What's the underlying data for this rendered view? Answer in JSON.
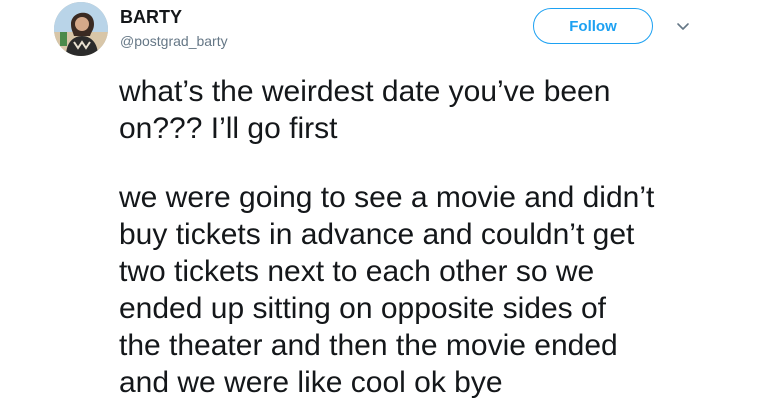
{
  "user": {
    "display_name": "BARTY",
    "handle": "@postgrad_barty"
  },
  "actions": {
    "follow_label": "Follow",
    "more_icon": "chevron-down-icon"
  },
  "tweet": {
    "paragraph_1": "what’s the weirdest date you’ve been\non??? I’ll go first",
    "paragraph_2": "we were going to see a movie and didn’t\nbuy tickets in advance and couldn’t get\ntwo tickets next to each other so we\nended up sitting on opposite sides of\nthe theater and then the movie ended\nand we were like cool ok bye"
  },
  "colors": {
    "accent": "#1da1f2",
    "text": "#14171a",
    "muted": "#657786"
  }
}
